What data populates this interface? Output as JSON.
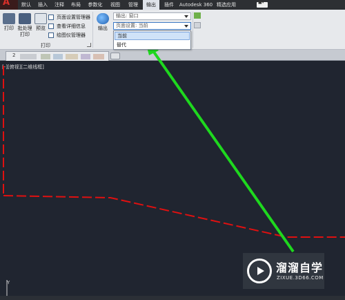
{
  "app": {
    "logo_glyph": "A"
  },
  "tabs": [
    {
      "label": "默认",
      "active": false
    },
    {
      "label": "插入",
      "active": false
    },
    {
      "label": "注释",
      "active": false
    },
    {
      "label": "布局",
      "active": false
    },
    {
      "label": "参数化",
      "active": false
    },
    {
      "label": "视图",
      "active": false
    },
    {
      "label": "管理",
      "active": false
    },
    {
      "label": "输出",
      "active": true
    },
    {
      "label": "插件",
      "active": false
    },
    {
      "label": "Autodesk 360",
      "active": false
    },
    {
      "label": "精选应用",
      "active": false
    }
  ],
  "ribbon": {
    "print_label": "打印",
    "batch_print_label": "批处理\n打印",
    "preview_label": "预览",
    "page_setup_manager": "页面设置管理器",
    "view_details": "查看详细信息",
    "plotter_manager": "绘图仪管理器",
    "print_panel_title": "打印",
    "output_label": "输出",
    "output_combo_value": "输出: 窗口",
    "page_setup_combo_value": "页面设置: 当前",
    "dropdown_options": [
      "当前",
      "替代"
    ],
    "dropdown_selected": "当前"
  },
  "file_tab": {
    "number": "2"
  },
  "canvas": {
    "view_label": "[-][俯视][二维线框]",
    "ucs_axis": "Y"
  },
  "watermark": {
    "title": "溜溜自学",
    "url": "ZIXUE.3D66.COM"
  },
  "colors": {
    "canvas_bg": "#202530",
    "line_red": "#e01010",
    "arrow_green": "#1ed81e",
    "accent": "#3b78c4"
  }
}
